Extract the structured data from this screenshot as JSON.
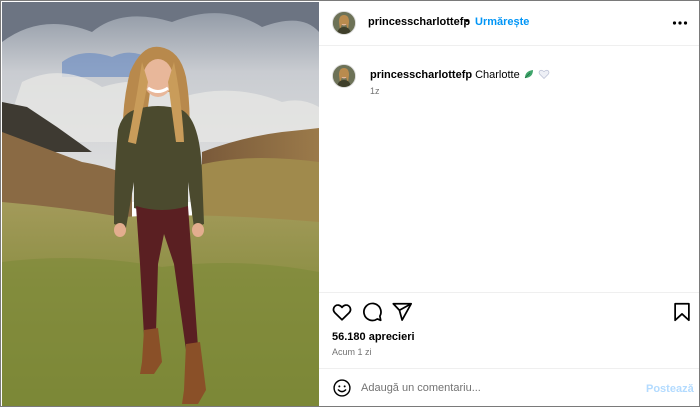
{
  "post": {
    "username": "princesscharlottefp",
    "separator": "•",
    "follow_label": "Urmărește",
    "more_icon": "more-horizontal-icon",
    "photo_alt": "Girl with long blonde hair in an olive sweater and burgundy leggings standing on a grassy hillside"
  },
  "caption": {
    "username": "princesscharlottefp",
    "text": "Charlotte",
    "emojis": [
      "leaf-emoji",
      "white-heart-emoji"
    ],
    "time": "1z"
  },
  "actions": {
    "like_icon": "heart-icon",
    "comment_icon": "comment-icon",
    "share_icon": "share-icon",
    "save_icon": "bookmark-icon"
  },
  "likes": "56.180 aprecieri",
  "posted": "Acum 1 zi",
  "comment": {
    "emoji_icon": "smiley-icon",
    "placeholder": "Adaugă un comentariu...",
    "post_label": "Postează"
  },
  "colors": {
    "accent": "#0095f6",
    "post_disabled": "#b3dbff",
    "secondary_text": "#737373"
  }
}
